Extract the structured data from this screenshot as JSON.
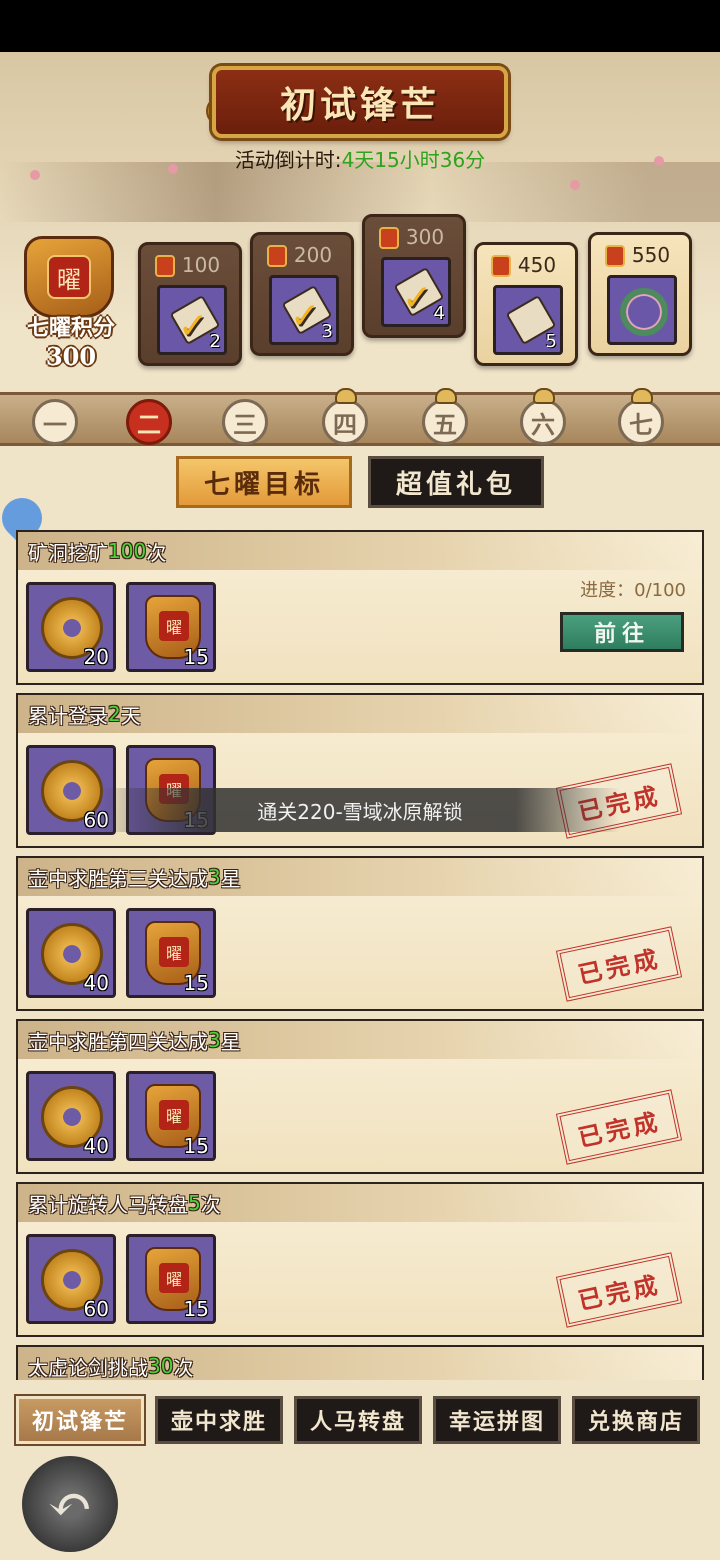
{
  "header": {
    "title": "初试锋芒",
    "countdown_label": "活动倒计时:",
    "countdown_value": "4天15小时36分"
  },
  "score": {
    "label": "七曜积分",
    "value": "300",
    "medal_char": "曜"
  },
  "milestones": [
    {
      "points": "100",
      "count": "2",
      "claimed": true
    },
    {
      "points": "200",
      "count": "3",
      "claimed": true
    },
    {
      "points": "300",
      "count": "4",
      "claimed": true
    },
    {
      "points": "450",
      "count": "5",
      "claimed": false
    },
    {
      "points": "550",
      "count": "",
      "claimed": false
    }
  ],
  "days": [
    {
      "label": "一",
      "state": "unlocked"
    },
    {
      "label": "二",
      "state": "active"
    },
    {
      "label": "三",
      "state": "unlocked"
    },
    {
      "label": "四",
      "state": "locked"
    },
    {
      "label": "五",
      "state": "locked"
    },
    {
      "label": "六",
      "state": "locked"
    },
    {
      "label": "七",
      "state": "locked"
    }
  ],
  "main_tabs": {
    "goals": "七曜目标",
    "packs": "超值礼包"
  },
  "tasks": [
    {
      "prefix": "矿洞挖矿",
      "num": "100",
      "suffix": "次",
      "coin": "20",
      "token": "15",
      "progress": "进度：0/100",
      "button": "前往"
    },
    {
      "prefix": "累计登录",
      "num": "2",
      "suffix": "天",
      "coin": "60",
      "token": "15",
      "stamp": "已完成"
    },
    {
      "prefix": "壶中求胜第三关达成",
      "num": "3",
      "suffix": "星",
      "coin": "40",
      "token": "15",
      "stamp": "已完成"
    },
    {
      "prefix": "壶中求胜第四关达成",
      "num": "3",
      "suffix": "星",
      "coin": "40",
      "token": "15",
      "stamp": "已完成"
    },
    {
      "prefix": "累计旋转人马转盘",
      "num": "5",
      "suffix": "次",
      "coin": "60",
      "token": "15",
      "stamp": "已完成"
    },
    {
      "prefix": "太虚论剑挑战",
      "num": "30",
      "suffix": "次"
    }
  ],
  "toast": "通关220-雪域冰原解锁",
  "bottom_nav": [
    "初试锋芒",
    "壶中求胜",
    "人马转盘",
    "幸运拼图",
    "兑换商店"
  ],
  "colors": {
    "highlight_green": "#4ad33a",
    "stamp_red": "#c0322a"
  },
  "icons": {
    "back": "back-arrow-icon"
  }
}
